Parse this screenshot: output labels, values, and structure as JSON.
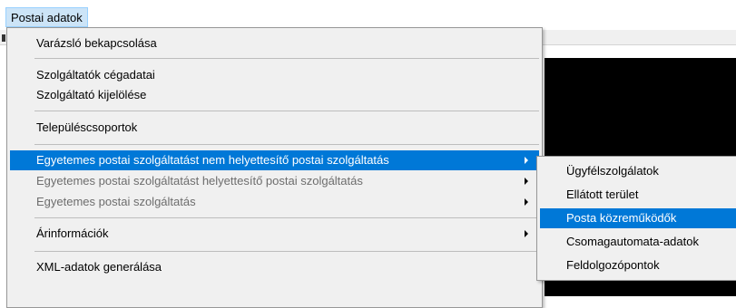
{
  "menubar": {
    "postai_adatok_label": "Postai adatok"
  },
  "main_menu": {
    "items": [
      {
        "label": "Varázsló bekapcsolása"
      },
      {
        "label": "Szolgáltatók cégadatai"
      },
      {
        "label": "Szolgáltató kijelölése"
      },
      {
        "label": "Településcsoportok"
      },
      {
        "label": "Egyetemes postai szolgáltatást nem helyettesítő postai szolgáltatás",
        "state": "highlighted",
        "has_submenu": true
      },
      {
        "label": "Egyetemes postai szolgáltatást helyettesítő postai szolgáltatás",
        "state": "disabled",
        "has_submenu": true
      },
      {
        "label": "Egyetemes postai szolgáltatás",
        "state": "disabled",
        "has_submenu": true
      },
      {
        "label": "Árinformációk",
        "has_submenu": true
      },
      {
        "label": "XML-adatok generálása"
      }
    ]
  },
  "submenu": {
    "items": [
      {
        "label": "Ügyfélszolgálatok"
      },
      {
        "label": "Ellátott terület"
      },
      {
        "label": "Posta közreműködők",
        "state": "highlighted"
      },
      {
        "label": "Csomagautomata-adatok"
      },
      {
        "label": "Feldolgozópontok"
      }
    ]
  },
  "colors": {
    "highlight": "#0078d7",
    "menu_background": "#f0f0f0",
    "disabled_text": "#6d6d6d",
    "menubar_active": "#cce4f7"
  },
  "icons": {
    "submenu_arrow": "chevron-right-icon"
  }
}
